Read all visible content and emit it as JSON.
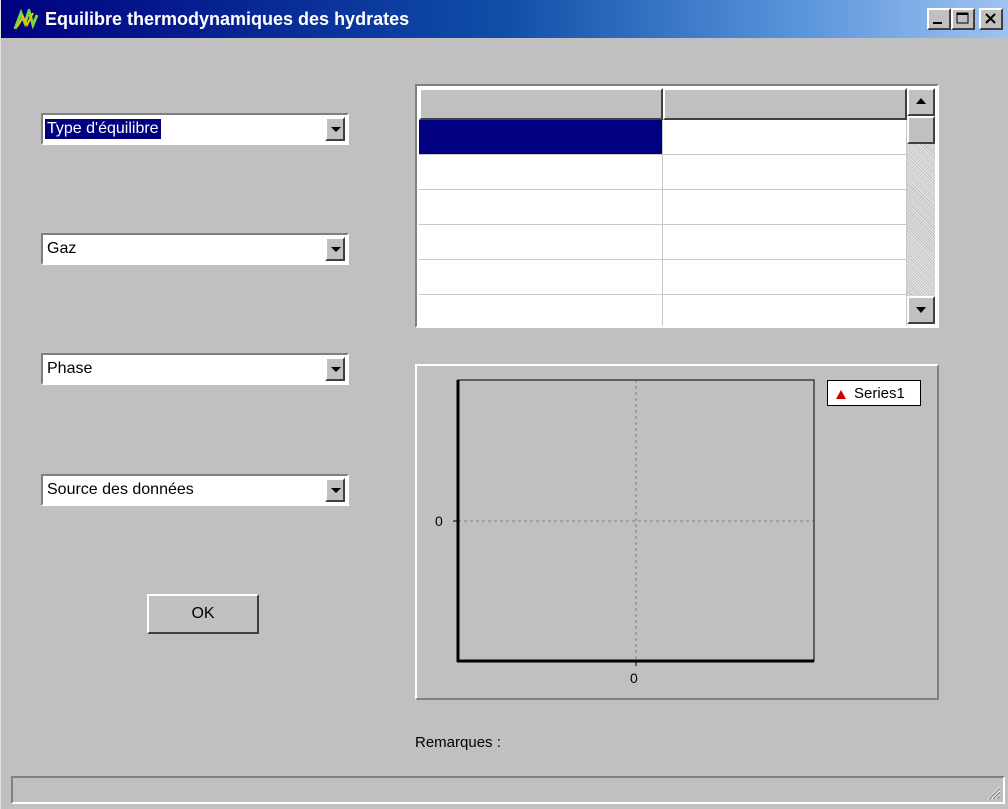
{
  "window": {
    "title": "Equilibre thermodynamiques des hydrates"
  },
  "form": {
    "combos": [
      {
        "value": "Type d'équilibre",
        "selected": true
      },
      {
        "value": "Gaz",
        "selected": false
      },
      {
        "value": "Phase",
        "selected": false
      },
      {
        "value": "Source des données",
        "selected": false
      }
    ],
    "ok_label": "OK"
  },
  "grid": {
    "columns": [
      "",
      ""
    ],
    "rows": [
      [
        "",
        ""
      ],
      [
        "",
        ""
      ],
      [
        "",
        ""
      ],
      [
        "",
        ""
      ],
      [
        "",
        ""
      ]
    ],
    "selected_cell": {
      "row": 0,
      "col": 0
    }
  },
  "chart_data": {
    "type": "scatter",
    "series": [
      {
        "name": "Series1",
        "marker": "triangle",
        "color": "#d00000",
        "values": []
      }
    ],
    "x_tick_labels": [
      "0"
    ],
    "y_tick_labels": [
      "0"
    ],
    "legend_position": "top-right",
    "grid": true
  },
  "remarks_label": "Remarques :",
  "colors": {
    "title_bar": "#000080",
    "face": "#c0c0c0",
    "selection": "#000080",
    "series_marker": "#d00000"
  }
}
